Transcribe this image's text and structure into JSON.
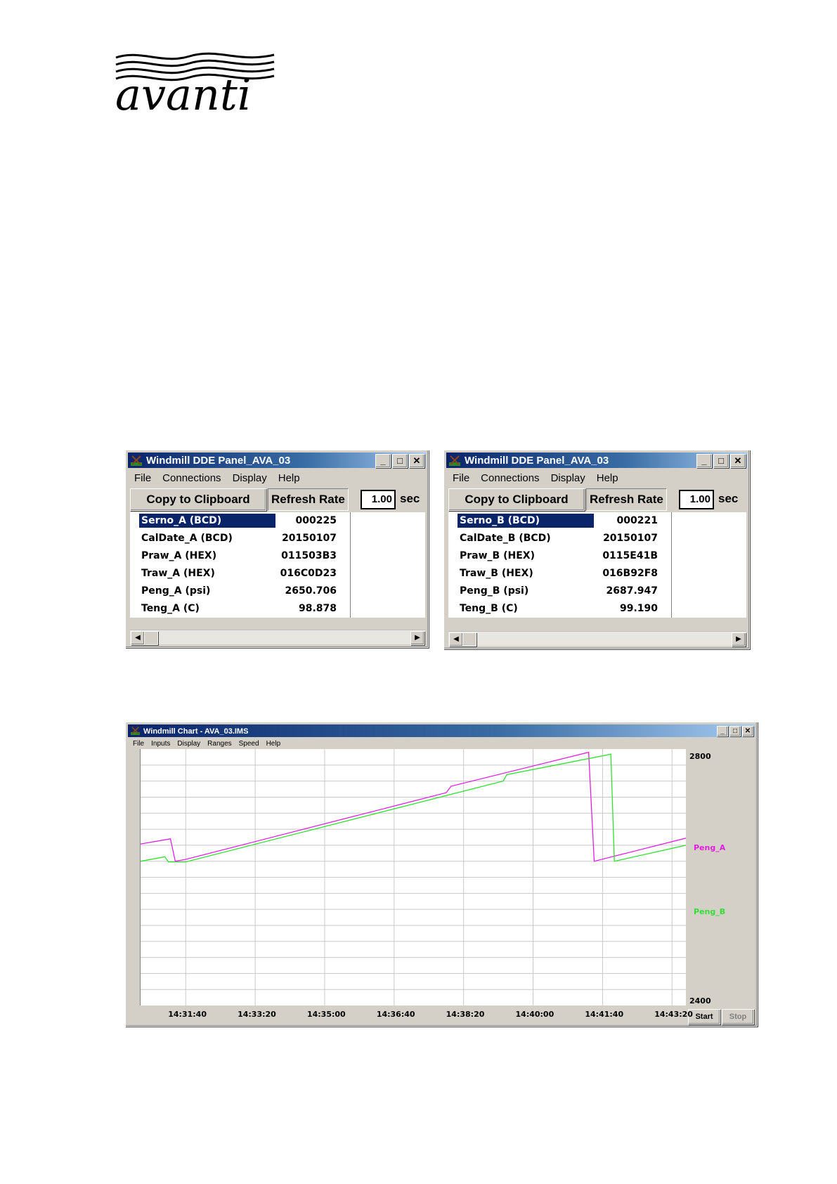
{
  "logo": {
    "text": "avanti"
  },
  "panel_a": {
    "title": "Windmill DDE Panel_AVA_03",
    "menu": [
      "File",
      "Connections",
      "Display",
      "Help"
    ],
    "copy_button": "Copy to Clipboard",
    "refresh_label": "Refresh Rate",
    "refresh_value": "1.00",
    "refresh_unit": "sec",
    "rows": [
      {
        "name": "Serno_A (BCD)",
        "value": "000225",
        "selected": true
      },
      {
        "name": "CalDate_A (BCD)",
        "value": "20150107"
      },
      {
        "name": "Praw_A (HEX)",
        "value": "011503B3"
      },
      {
        "name": "Traw_A (HEX)",
        "value": "016C0D23"
      },
      {
        "name": "Peng_A (psi)",
        "value": "2650.706"
      },
      {
        "name": "Teng_A (C)",
        "value": "98.878"
      }
    ]
  },
  "panel_b": {
    "title": "Windmill DDE Panel_AVA_03",
    "menu": [
      "File",
      "Connections",
      "Display",
      "Help"
    ],
    "copy_button": "Copy to Clipboard",
    "refresh_label": "Refresh Rate",
    "refresh_value": "1.00",
    "refresh_unit": "sec",
    "rows": [
      {
        "name": "Serno_B (BCD)",
        "value": "000221",
        "selected": true
      },
      {
        "name": "CalDate_B (BCD)",
        "value": "20150107"
      },
      {
        "name": "Praw_B (HEX)",
        "value": "0115E41B"
      },
      {
        "name": "Traw_B (HEX)",
        "value": "016B92F8"
      },
      {
        "name": "Peng_B (psi)",
        "value": "2687.947"
      },
      {
        "name": "Teng_B (C)",
        "value": "99.190"
      }
    ]
  },
  "chart_window": {
    "title": "Windmill Chart - AVA_03.IMS",
    "menu": [
      "File",
      "Inputs",
      "Display",
      "Ranges",
      "Speed",
      "Help"
    ],
    "start_button": "Start",
    "stop_button": "Stop"
  },
  "chart_data": {
    "type": "line",
    "x_ticks": [
      "14:31:40",
      "14:33:20",
      "14:35:00",
      "14:36:40",
      "14:38:20",
      "14:40:00",
      "14:41:40",
      "14:43:20"
    ],
    "x_range_seconds_from_1430": [
      35,
      820
    ],
    "ylim": [
      2400,
      2800
    ],
    "y_ticks": [
      "2800",
      "2400"
    ],
    "grid": true,
    "series": [
      {
        "name": "Peng_A",
        "color": "#e020e0",
        "points": [
          [
            35,
            2652
          ],
          [
            78,
            2660
          ],
          [
            85,
            2625
          ],
          [
            100,
            2628
          ],
          [
            475,
            2732
          ],
          [
            482,
            2742
          ],
          [
            680,
            2795
          ],
          [
            688,
            2625
          ],
          [
            820,
            2661
          ]
        ]
      },
      {
        "name": "Peng_B",
        "color": "#30e030",
        "points": [
          [
            35,
            2625
          ],
          [
            70,
            2632
          ],
          [
            75,
            2624
          ],
          [
            82,
            2624
          ],
          [
            100,
            2624
          ],
          [
            557,
            2750
          ],
          [
            562,
            2760
          ],
          [
            712,
            2792
          ],
          [
            717,
            2625
          ],
          [
            820,
            2650
          ]
        ]
      }
    ]
  }
}
